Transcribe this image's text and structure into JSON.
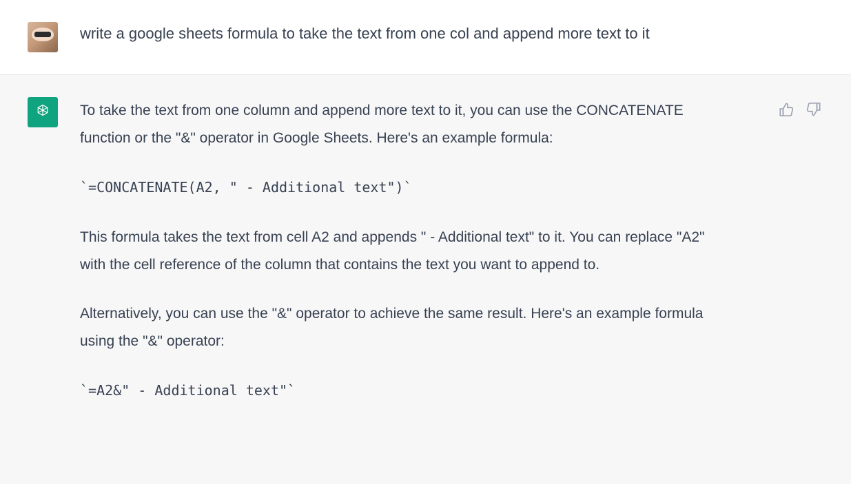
{
  "conversation": {
    "user": {
      "text": "write a google sheets formula to take the text from one col and append more text to it"
    },
    "assistant": {
      "p1": "To take the text from one column and append more text to it, you can use the CONCATENATE function or the \"&\" operator in Google Sheets. Here's an example formula:",
      "code1": "`=CONCATENATE(A2, \" - Additional text\")`",
      "p2": "This formula takes the text from cell A2 and appends \" - Additional text\" to it. You can replace \"A2\" with the cell reference of the column that contains the text you want to append to.",
      "p3": "Alternatively, you can use the \"&\" operator to achieve the same result. Here's an example formula using the \"&\" operator:",
      "code2": "`=A2&\" - Additional text\"`"
    }
  },
  "icons": {
    "assistant_logo": "openai-logo-icon",
    "thumbs_up": "thumbs-up-icon",
    "thumbs_down": "thumbs-down-icon"
  }
}
